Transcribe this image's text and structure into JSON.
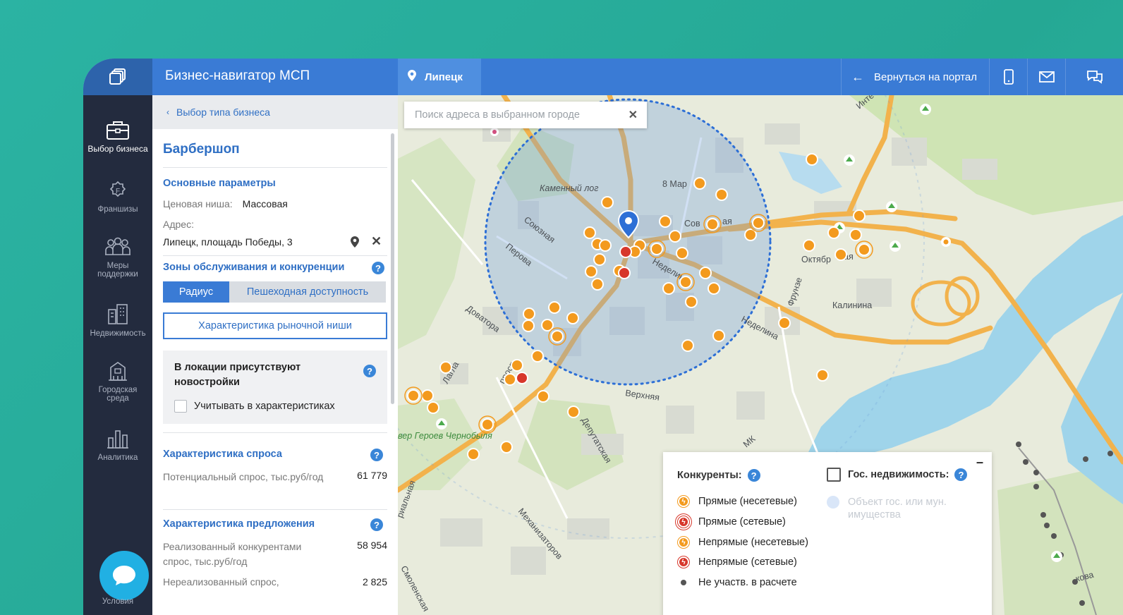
{
  "app": {
    "title": "Бизнес-навигатор МСП"
  },
  "topbar": {
    "city": "Липецк",
    "back_label": "Вернуться на портал"
  },
  "rail": {
    "items": [
      {
        "label": "Выбор бизнеса",
        "icon": "briefcase-icon"
      },
      {
        "label": "Франшизы",
        "icon": "franchise-icon"
      },
      {
        "label": "Меры поддержки",
        "icon": "people-icon"
      },
      {
        "label": "Недвижимость",
        "icon": "buildings-icon"
      },
      {
        "label": "Городская среда",
        "icon": "city-icon"
      },
      {
        "label": "Аналитика",
        "icon": "chart-icon"
      }
    ],
    "conditions_label": "Условия"
  },
  "panel": {
    "breadcrumb": "Выбор типа бизнеса",
    "business_title": "Барбершоп",
    "main_params": {
      "title": "Основные параметры",
      "price_label": "Ценовая ниша:",
      "price_value": "Массовая",
      "address_label": "Адрес:",
      "address_value": "Липецк, площадь Победы, 3"
    },
    "zones": {
      "title": "Зоны обслуживания и конкуренции",
      "tab_radius": "Радиус",
      "tab_walk": "Пешеходная доступность",
      "niche_button": "Характеристика рыночной ниши"
    },
    "newbuild": {
      "title": "В локации присутствуют новостройки",
      "checkbox_label": "Учитывать в характеристиках"
    },
    "demand": {
      "title": "Характеристика спроса",
      "label": "Потенциальный спрос, тыс.руб/год",
      "value": "61 779"
    },
    "supply": {
      "title": "Характеристика предложения",
      "label1": "Реализованный конкурентами спрос, тыс.руб/год",
      "value1": "58 954",
      "label2": "Нереализованный спрос,",
      "value2": "2 825"
    }
  },
  "map": {
    "search_placeholder": "Поиск адреса в выбранном городе",
    "labels": {
      "kamenny_log": "Каменный лог",
      "mar8": "8 Мар",
      "sov": "Сов",
      "aya": "ая",
      "soyuznaya": "Союзная",
      "perova": "Перова",
      "nedelina_c": "Неделина",
      "oktyabr": "Октябр",
      "skaya": "ская",
      "frunze": "Фрунзе",
      "kalinina": "Калинина",
      "nedelina": "Неделина",
      "dovatora": "Доватора",
      "lagla": "Лагла",
      "prosp": "просп",
      "verkhnyaya": "Верхняя",
      "deputatskaya": "Депутатская",
      "skver": "вер Героев Чернобыля",
      "rialnaya": "риальная",
      "mekhanizatorov": "Механизаторов",
      "smolenskaya": "Смоленская",
      "mk": "МК",
      "inte": "Инте",
      "kova": "кова"
    },
    "legend": {
      "competitors_title": "Конкуренты:",
      "gov_title": "Гос. недвижимость:",
      "items": [
        "Прямые (несетевые)",
        "Прямые (сетевые)",
        "Непрямые (несетевые)",
        "Непрямые (сетевые)",
        "Не участв. в расчете"
      ],
      "gov_item": "Объект гос. или мун. имущества",
      "minimize": "–"
    },
    "colors": {
      "marker_orange": "#f39a1e",
      "marker_red": "#d7372b",
      "radius_fill": "#6f9fdc",
      "road": "#f2b24c"
    }
  }
}
